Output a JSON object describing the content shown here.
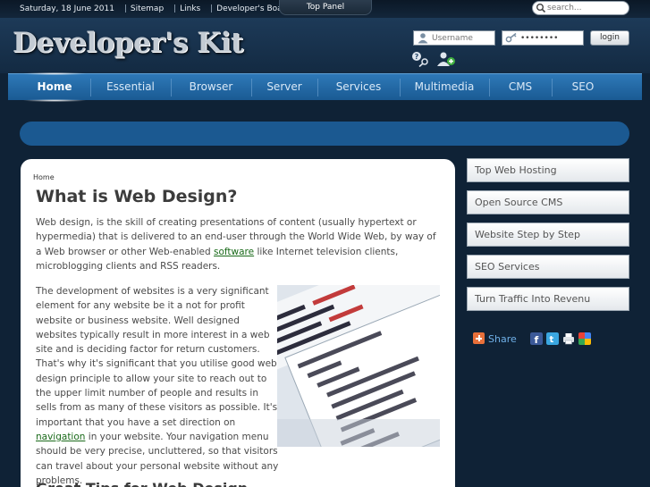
{
  "topbar": {
    "date": "Saturday, 18 June 2011",
    "links": [
      "Sitemap",
      "Links",
      "Developer's Board"
    ],
    "panel_label": "Top Panel",
    "search_placeholder": "search..."
  },
  "header": {
    "logo_text": "Developer's Kit",
    "username_placeholder": "Username",
    "password_value": "••••••••",
    "login_label": "login"
  },
  "nav": {
    "items": [
      "Home",
      "Essential",
      "Browser",
      "Server",
      "Services",
      "Multimedia",
      "CMS",
      "SEO"
    ]
  },
  "main": {
    "breadcrumb": "Home",
    "title": "What is Web Design?",
    "p1_before": "Web design,  is the skill of creating presentations of content (usually hypertext or hypermedia) that is delivered to an end-user through the World Wide Web, by way of a Web browser or other Web-enabled ",
    "p1_link": "software",
    "p1_after": " like Internet television clients, microblogging clients and RSS readers.",
    "p2_before": "The development of websites is a very significant element for any website be it a not for profit website or business website. Well designed websites typically result in more interest in a web site and is deciding factor for return customers. That's why it's significant that you utilise good web design principle to allow your site to reach out to the upper limit number of people and results in sells from as many of these visitors as possible. It's important that you have a set direction on ",
    "p2_link": "navigation",
    "p2_after": " in your website. Your navigation menu should be very precise, uncluttered, so that visitors can travel about your personal website without any problems.",
    "sub_title": "Great Tips for Web Design"
  },
  "sidebar": {
    "items": [
      "Top Web Hosting",
      "Open Source CMS",
      "Website Step by Step",
      "SEO Services",
      "Turn Traffic Into Revenu"
    ],
    "share_label": "Share"
  },
  "colors": {
    "nav": "#2a6fae",
    "band": "#1b5991",
    "link": "#1a6a1a",
    "background": "#0f2236"
  }
}
